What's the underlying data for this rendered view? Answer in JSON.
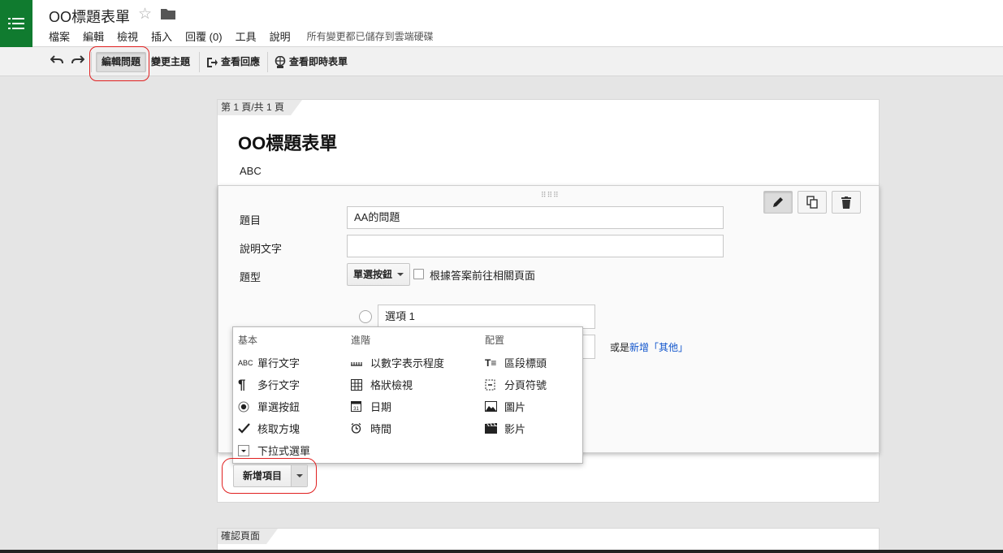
{
  "app": {
    "doc_title": "OO標題表單",
    "saved_status": "所有變更都已儲存到雲端硬碟"
  },
  "menu": [
    "檔案",
    "編輯",
    "檢視",
    "插入",
    "回覆 (0)",
    "工具",
    "說明"
  ],
  "toolbar": {
    "edit_questions": "編輯問題",
    "change_theme": "變更主題",
    "view_responses": "查看回應",
    "view_live_form": "查看即時表單"
  },
  "form": {
    "page_indicator": "第 1 頁/共 1 頁",
    "title": "OO標題表單",
    "description": "ABC"
  },
  "question": {
    "title_label": "題目",
    "title_value": "AA的問題",
    "help_label": "說明文字",
    "help_value": "",
    "type_label": "題型",
    "type_value": "單選按鈕",
    "goto_label": "根據答案前往相關頁面",
    "option1": "選項 1",
    "add_other_prefix": "或是",
    "add_other_link": "新增「其他」"
  },
  "dropdown": {
    "basic_header": "基本",
    "basic": [
      {
        "icon": "abc-text-icon",
        "label": "單行文字"
      },
      {
        "icon": "paragraph-icon",
        "label": "多行文字"
      },
      {
        "icon": "radio-icon",
        "label": "單選按鈕"
      },
      {
        "icon": "checkbox-icon",
        "label": "核取方塊"
      },
      {
        "icon": "dropdown-icon",
        "label": "下拉式選單"
      }
    ],
    "advanced_header": "進階",
    "advanced": [
      {
        "icon": "scale-icon",
        "label": "以數字表示程度"
      },
      {
        "icon": "grid-icon",
        "label": "格狀檢視"
      },
      {
        "icon": "calendar-icon",
        "label": "日期"
      },
      {
        "icon": "clock-icon",
        "label": "時間"
      }
    ],
    "layout_header": "配置",
    "layout": [
      {
        "icon": "section-header-icon",
        "label": "區段標頭"
      },
      {
        "icon": "page-break-icon",
        "label": "分頁符號"
      },
      {
        "icon": "image-icon",
        "label": "圖片"
      },
      {
        "icon": "video-icon",
        "label": "影片"
      }
    ]
  },
  "add_item": {
    "label": "新增項目"
  },
  "confirmation": {
    "label": "確認頁面"
  }
}
